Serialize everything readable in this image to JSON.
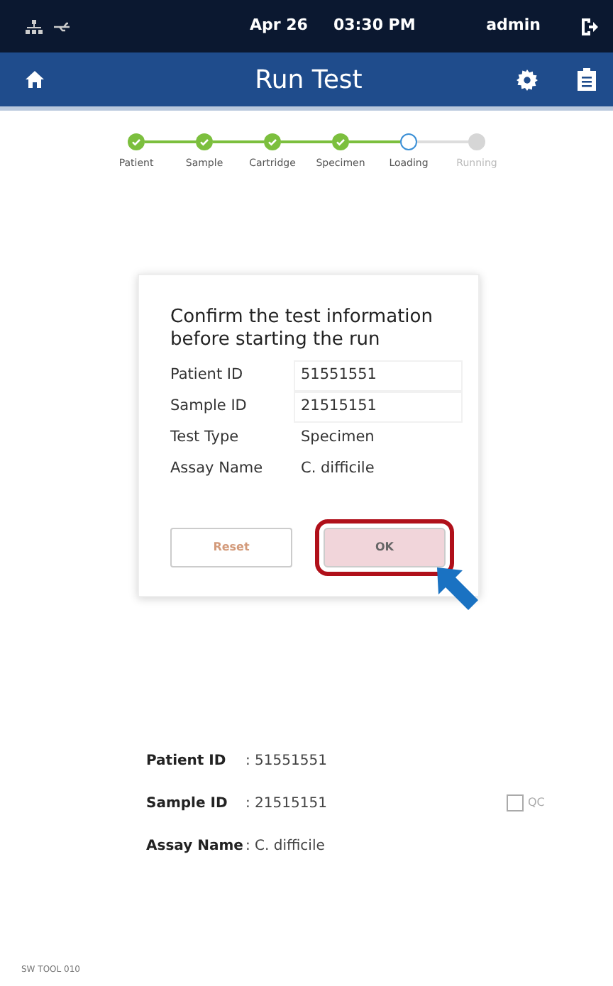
{
  "status_bar": {
    "date": "Apr 26",
    "time": "03:30 PM",
    "user": "admin"
  },
  "header": {
    "title": "Run Test"
  },
  "steps": [
    {
      "label": "Patient",
      "kind": "done"
    },
    {
      "label": "Sample",
      "kind": "done"
    },
    {
      "label": "Cartridge",
      "kind": "done"
    },
    {
      "label": "Specimen",
      "kind": "done"
    },
    {
      "label": "Loading",
      "kind": "current"
    },
    {
      "label": "Running",
      "kind": "pending"
    }
  ],
  "dialog": {
    "title": "Confirm the test information before starting the run",
    "fields": [
      {
        "label": "Patient ID",
        "value": "51551551",
        "kind": "field"
      },
      {
        "label": "Sample ID",
        "value": "21515151",
        "kind": "field"
      },
      {
        "label": "Test Type",
        "value": "Specimen",
        "kind": "text"
      },
      {
        "label": "Assay Name",
        "value": "C. difficile",
        "kind": "text"
      }
    ],
    "buttons": [
      {
        "label": "Reset",
        "highlighted": false
      },
      {
        "label": "OK",
        "highlighted": true
      }
    ]
  },
  "summary": {
    "rows": [
      {
        "label": "Patient ID",
        "value": ": 51551551"
      },
      {
        "label": "Sample ID",
        "value": ": 21515151"
      },
      {
        "label": "Assay Name",
        "value": ": C. difficile"
      }
    ],
    "qc": {
      "label": "QC",
      "checked": false
    }
  },
  "footer": {
    "version": "SW TOOL 010"
  }
}
